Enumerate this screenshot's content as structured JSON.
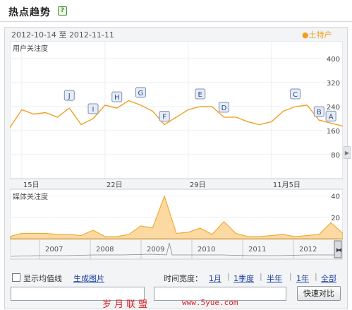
{
  "header": {
    "title": "热点趋势",
    "help_icon": "help-icon",
    "help_glyph": "?"
  },
  "panel": {
    "date_range": {
      "start": "2012-10-14",
      "sep": "至",
      "end": "2012-11-11"
    },
    "legend_series": "●土特产",
    "legend_color": "#f0a020"
  },
  "user_chart": {
    "label": "用户关注度",
    "y_ticks": [
      "400",
      "320",
      "240",
      "160",
      "80"
    ],
    "x_ticks": [
      "15日",
      "22日",
      "29日",
      "11月5日"
    ]
  },
  "media_chart": {
    "label": "媒体关注度",
    "y_ticks": [
      "40",
      "20"
    ]
  },
  "timeline": {
    "years": [
      "2007",
      "2008",
      "2009",
      "2010",
      "2011",
      "2012"
    ]
  },
  "controls": {
    "show_avg_label": "显示均值线",
    "generate_image_label": "生成图片",
    "time_span_label": "时间宽度：",
    "spans": [
      "1月",
      "1季度",
      "半年",
      "1年",
      "全部"
    ],
    "compare_button": "快速对比"
  },
  "watermark": {
    "text": "岁月联盟",
    "url": "www.5yue.com"
  },
  "chart_data": {
    "type": "line",
    "colors": {
      "line": "#f0a020",
      "area": "#fbd9a0"
    },
    "user_attention": {
      "x_range": [
        "2012-10-14",
        "2012-11-11"
      ],
      "ylim": [
        0,
        440
      ],
      "x": [
        "10-14",
        "10-15",
        "10-16",
        "10-17",
        "10-18",
        "10-19",
        "10-20",
        "10-21",
        "10-22",
        "10-23",
        "10-24",
        "10-25",
        "10-26",
        "10-27",
        "10-28",
        "10-29",
        "10-30",
        "10-31",
        "11-01",
        "11-02",
        "11-03",
        "11-04",
        "11-05",
        "11-06",
        "11-07",
        "11-08",
        "11-09",
        "11-10",
        "11-11"
      ],
      "values": [
        170,
        230,
        215,
        220,
        205,
        235,
        180,
        200,
        245,
        235,
        260,
        245,
        225,
        180,
        205,
        230,
        240,
        240,
        205,
        205,
        190,
        180,
        190,
        225,
        240,
        245,
        195,
        185,
        175
      ],
      "annotations": [
        {
          "label": "J",
          "date": "10-19"
        },
        {
          "label": "I",
          "date": "10-21"
        },
        {
          "label": "H",
          "date": "10-23"
        },
        {
          "label": "G",
          "date": "10-25"
        },
        {
          "label": "F",
          "date": "10-27"
        },
        {
          "label": "E",
          "date": "10-30"
        },
        {
          "label": "D",
          "date": "11-01"
        },
        {
          "label": "C",
          "date": "11-07"
        },
        {
          "label": "B",
          "date": "11-09"
        },
        {
          "label": "A",
          "date": "11-10"
        }
      ]
    },
    "media_attention": {
      "ylim": [
        0,
        45
      ],
      "values": [
        2,
        5,
        5,
        5,
        4,
        4,
        3,
        8,
        2,
        2,
        4,
        12,
        10,
        40,
        5,
        6,
        10,
        4,
        16,
        5,
        2,
        2,
        3,
        4,
        2,
        3,
        4,
        15,
        5
      ]
    },
    "timeline_years": [
      "2007",
      "2008",
      "2009",
      "2010",
      "2011",
      "2012"
    ]
  }
}
